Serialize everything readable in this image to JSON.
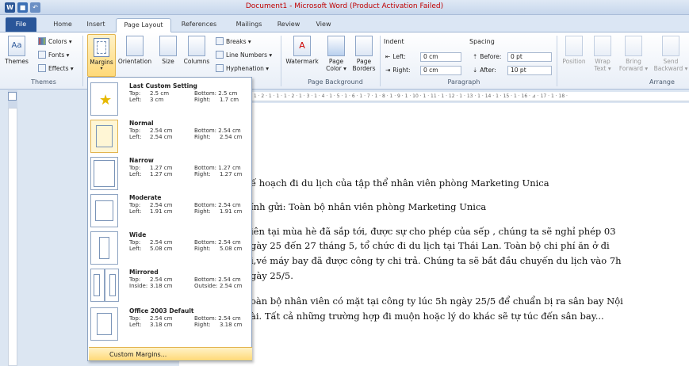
{
  "window": {
    "title": "Document1 - Microsoft Word (Product Activation Failed)",
    "qat": [
      "W",
      "save",
      "undo"
    ]
  },
  "tabs": [
    "File",
    "Home",
    "Insert",
    "Page Layout",
    "References",
    "Mailings",
    "Review",
    "View"
  ],
  "ribbon": {
    "themes": {
      "themes": "Themes",
      "colors": "Colors ▾",
      "fonts": "Fonts ▾",
      "effects": "Effects ▾",
      "group": "Themes"
    },
    "page_setup": {
      "margins": "Margins",
      "orientation": "Orientation",
      "size": "Size",
      "columns": "Columns",
      "breaks": "Breaks ▾",
      "line_numbers": "Line Numbers ▾",
      "hyphenation": "Hyphenation ▾"
    },
    "page_background": {
      "watermark": "Watermark",
      "page_color": "Page Color ▾",
      "page_borders": "Page Borders",
      "group": "Page Background"
    },
    "paragraph": {
      "indent": "Indent",
      "spacing": "Spacing",
      "left_label": "Left:",
      "left_value": "0 cm",
      "right_label": "Right:",
      "right_value": "0 cm",
      "before_label": "Before:",
      "before_value": "0 pt",
      "after_label": "After:",
      "after_value": "10 pt",
      "group": "Paragraph"
    },
    "arrange": {
      "position": "Position",
      "wrap_text": "Wrap Text ▾",
      "bring_forward": "Bring Forward ▾",
      "send_backward": "Send Backward ▾",
      "group": "Arrange"
    }
  },
  "margins_menu": {
    "options": [
      {
        "name": "Last Custom Setting",
        "l1a": "Top:",
        "l1b": "2.5 cm",
        "l1c": "Bottom: 2.5 cm",
        "l2a": "Left:",
        "l2b": "3 cm",
        "l2c": "Right:",
        "l2d": "1.7 cm"
      },
      {
        "name": "Normal",
        "l1a": "Top:",
        "l1b": "2.54 cm",
        "l1c": "Bottom: 2.54 cm",
        "l2a": "Left:",
        "l2b": "2.54 cm",
        "l2c": "Right:",
        "l2d": "2.54 cm"
      },
      {
        "name": "Narrow",
        "l1a": "Top:",
        "l1b": "1.27 cm",
        "l1c": "Bottom: 1.27 cm",
        "l2a": "Left:",
        "l2b": "1.27 cm",
        "l2c": "Right:",
        "l2d": "1.27 cm"
      },
      {
        "name": "Moderate",
        "l1a": "Top:",
        "l1b": "2.54 cm",
        "l1c": "Bottom: 2.54 cm",
        "l2a": "Left:",
        "l2b": "1.91 cm",
        "l2c": "Right:",
        "l2d": "1.91 cm"
      },
      {
        "name": "Wide",
        "l1a": "Top:",
        "l1b": "2.54 cm",
        "l1c": "Bottom: 2.54 cm",
        "l2a": "Left:",
        "l2b": "5.08 cm",
        "l2c": "Right:",
        "l2d": "5.08 cm"
      },
      {
        "name": "Mirrored",
        "l1a": "Top:",
        "l1b": "2.54 cm",
        "l1c": "Bottom: 2.54 cm",
        "l2a": "Inside:",
        "l2b": "3.18 cm",
        "l2c": "Outside:",
        "l2d": "2.54 cm"
      },
      {
        "name": "Office 2003 Default",
        "l1a": "Top:",
        "l1b": "2.54 cm",
        "l1c": "Bottom: 2.54 cm",
        "l2a": "Left:",
        "l2b": "3.18 cm",
        "l2c": "Right:",
        "l2d": "3.18 cm"
      }
    ],
    "custom": "Custom Margins..."
  },
  "document": {
    "lines": [
      "ế hoạch đi du lịch của tập thể nhân viên phòng Marketing Unica",
      "ính gửi:  Toàn bộ nhân viên phòng Marketing Unica",
      "iên tại mùa hè đã sắp tới, được sự cho phép của sếp , chúng ta sẽ nghỉ phép 03",
      "gày 25 đến 27 tháng 5, tổ chức đi du lịch tại Thái Lan. Toàn bộ chi phí ăn ở đi",
      "i,vé máy bay đã được công ty chi trả. Chúng ta sẽ bắt đầu chuyến du lịch vào 7h",
      "gày 25/5.",
      "oàn bộ nhân viên có mặt tại công ty lúc 5h  ngày 25/5 để chuẩn bị ra sân bay Nội",
      "ài. Tất cả những trường hợp đi muộn hoặc lý do khác sẽ tự túc đến sân bay..."
    ]
  },
  "ruler": "· 1 · 2 · 1 · 1 · 1 · 2 · 1 · 3 · 1 · 4 · 1 · 5 · 1 · 6 · 1 · 7 · 1 · 8 · 1 · 9 · 1 · 10 · 1 · 11 · 1 · 12 · 1 · 13 · 1 · 14 · 1 · 15 · 1 · 16 · ⊿ · 17 · 1 · 18 ·",
  "colors": {
    "file_tab": "#2a5699",
    "title_red": "#c00000",
    "highlight": "#ffd978"
  }
}
